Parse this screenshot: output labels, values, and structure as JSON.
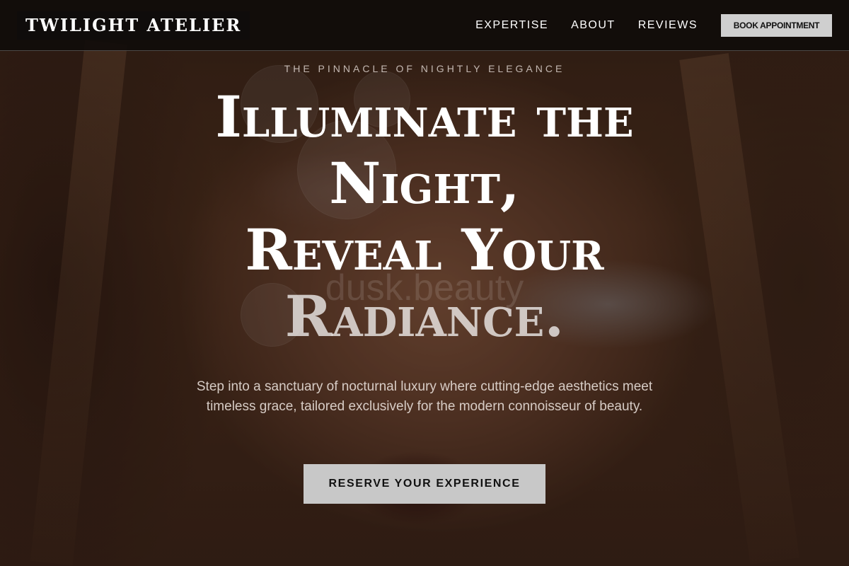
{
  "header": {
    "brand": "TWILIGHT ATELIER",
    "nav": [
      "EXPERTISE",
      "ABOUT",
      "REVIEWS"
    ],
    "cta_label": "BOOK APPOINTMENT"
  },
  "hero": {
    "eyebrow": "THE PINNACLE OF NIGHTLY ELEGANCE",
    "headline_lines": [
      "Illuminate the",
      "Night,",
      "Reveal Your",
      "Radiance."
    ],
    "watermark": "dusk.beauty",
    "subtext": "Step into a sanctuary of nocturnal luxury where cutting-edge aesthetics meet timeless grace, tailored exclusively for the modern connoisseur of beauty.",
    "cta_label": "RESERVE YOUR EXPERIENCE"
  },
  "colors": {
    "header_bg": "#100c0a",
    "button_bg": "#cfcfcf",
    "text": "#ffffff"
  }
}
